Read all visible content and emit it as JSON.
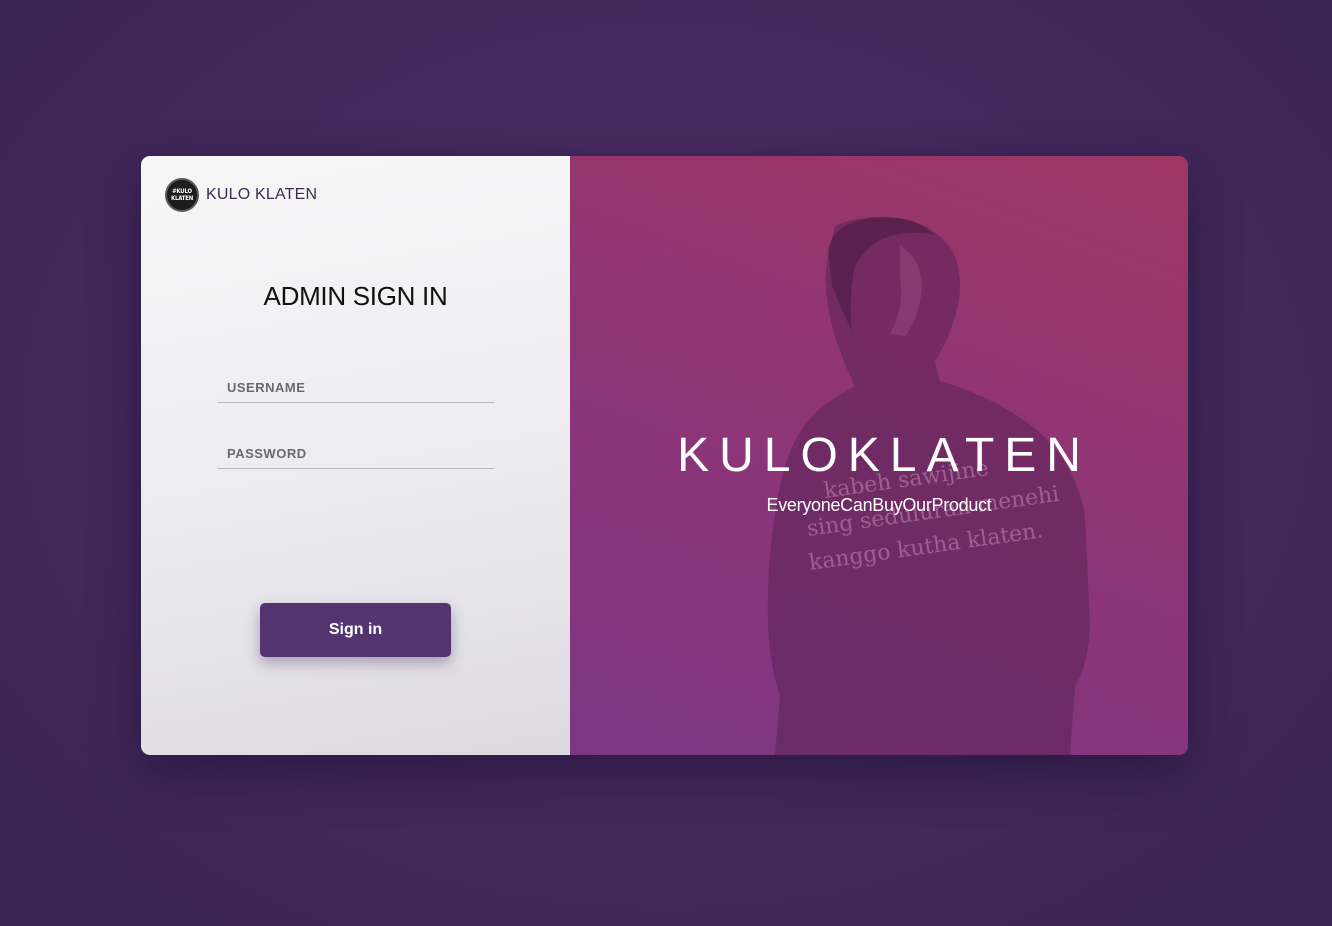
{
  "brand": {
    "logo_text": [
      "#KULO",
      "KLATEN"
    ],
    "name": "KULO KLATEN"
  },
  "form": {
    "title": "ADMIN SIGN IN",
    "username_placeholder": "USERNAME",
    "password_placeholder": "PASSWORD",
    "submit_label": "Sign in"
  },
  "hero": {
    "title": "KULOKLATEN",
    "tagline": "EveryoneCanBuyOurProduct",
    "photo_shirt_text": [
      "kabeh sawijine",
      "sing seduluran menehi",
      "kanggo kutha klaten."
    ]
  },
  "colors": {
    "background": "#43295e",
    "button": "#54346f",
    "hero_gradient_start": "#7b3683",
    "hero_gradient_end": "#9e3664"
  }
}
